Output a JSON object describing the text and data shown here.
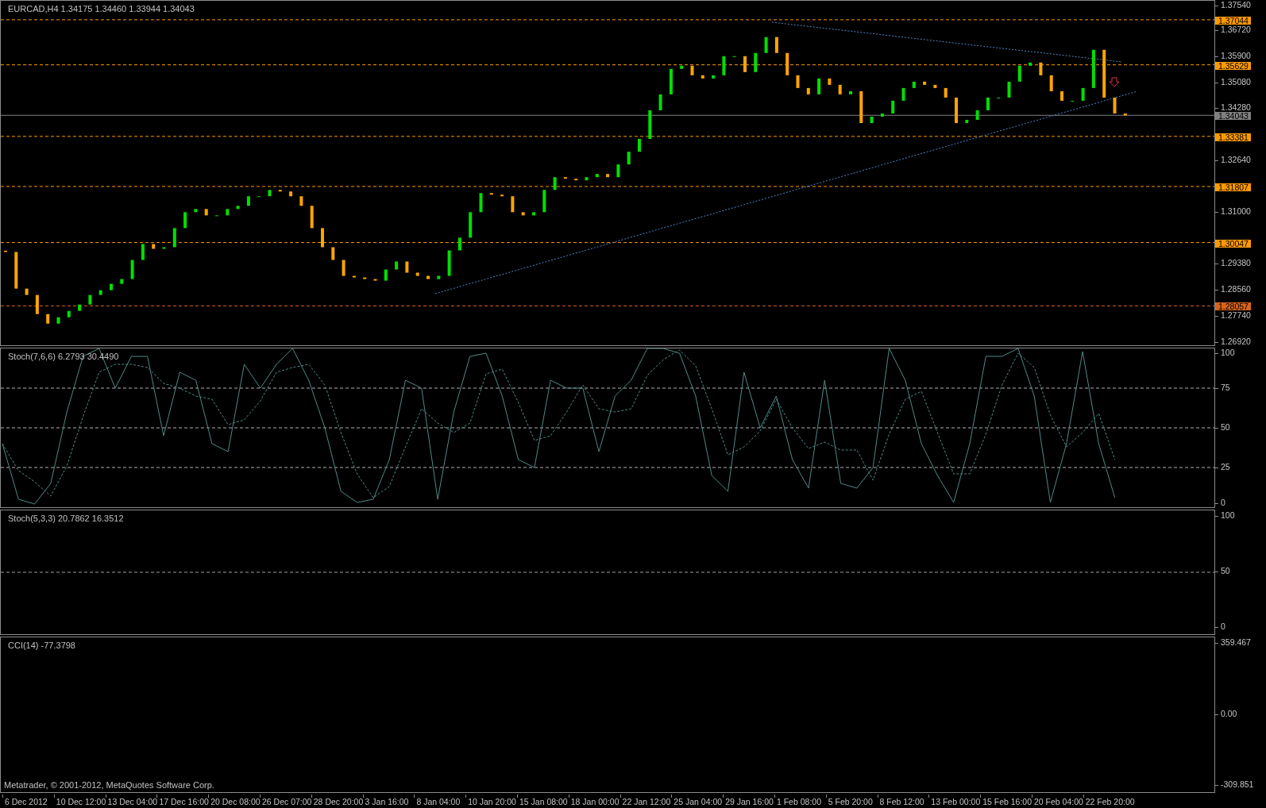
{
  "main_chart": {
    "title": "EURCAD,H4  1.34175 1.34460 1.33944 1.34043",
    "price_scale": [
      "1.37540",
      "1.36720",
      "1.35900",
      "1.35080",
      "1.34280",
      "1.32640",
      "1.31000",
      "1.29380",
      "1.28560",
      "1.27740",
      "1.26920"
    ],
    "levels": [
      {
        "label": "1.37044",
        "kind": "dashed",
        "color": "#ff9900"
      },
      {
        "label": "1.35629",
        "kind": "dashed",
        "color": "#ff9900"
      },
      {
        "label": "1.34043",
        "kind": "current",
        "color": "#808080"
      },
      {
        "label": "1.33381",
        "kind": "dashed",
        "color": "#ff9900"
      },
      {
        "label": "1.31807",
        "kind": "dashed",
        "color": "#ff9900"
      },
      {
        "label": "1.30047",
        "kind": "dashed",
        "color": "#ff9900"
      },
      {
        "label": "1.28057",
        "kind": "dashed",
        "color": "#d8641c"
      }
    ]
  },
  "stoch_panel": {
    "label": "Stoch(7,6,6) 6.2793 30.4490",
    "chart_data": {
      "type": "line",
      "ylim": [
        0,
        100
      ],
      "grid": true,
      "yticks": [
        {
          "value": 0,
          "label": "0"
        },
        {
          "value": 25,
          "label": "25"
        },
        {
          "value": 50,
          "label": "50"
        },
        {
          "value": 75,
          "label": "75"
        },
        {
          "value": 100,
          "label": "100"
        }
      ],
      "series": [
        {
          "color": "#4f8a86",
          "line_style": "solid",
          "values": [
            40,
            5,
            2,
            15,
            60,
            95,
            100,
            75,
            95,
            95,
            45,
            85,
            80,
            40,
            35,
            90,
            75,
            90,
            100,
            80,
            50,
            10,
            3,
            5,
            30,
            80,
            75,
            5,
            60,
            95,
            97,
            70,
            30,
            25,
            80,
            75,
            75,
            35,
            70,
            80,
            100,
            100,
            97,
            70,
            20,
            10,
            85,
            50,
            70,
            30,
            12,
            80,
            15,
            12,
            25,
            100,
            80,
            40,
            20,
            3,
            40,
            95,
            95,
            100,
            70,
            3,
            40,
            98,
            40,
            6
          ]
        },
        {
          "color": "#4f8a86",
          "line_style": "dashed",
          "values": [
            40,
            23,
            16,
            7,
            26,
            57,
            85,
            90,
            90,
            88,
            78,
            75,
            70,
            68,
            52,
            55,
            67,
            85,
            88,
            90,
            77,
            47,
            21,
            6,
            13,
            38,
            62,
            53,
            47,
            53,
            84,
            87,
            66,
            42,
            45,
            60,
            77,
            62,
            60,
            62,
            83,
            93,
            99,
            89,
            62,
            33,
            38,
            48,
            68,
            50,
            37,
            41,
            36,
            36,
            17,
            46,
            68,
            73,
            47,
            21,
            21,
            46,
            77,
            97,
            88,
            58,
            38,
            47,
            59,
            30
          ]
        }
      ]
    }
  },
  "stoch_panel_2": {
    "label": "Stoch(5,3,3) 20.7862 16.3512",
    "scale": [
      "100",
      "50",
      "0"
    ]
  },
  "cci_panel": {
    "label": "CCI(14) -77.3798",
    "scale": [
      "359.467",
      "0.00",
      "-309.851"
    ],
    "copyright": "Metatrader, © 2001-2012, MetaQuotes Software Corp."
  },
  "time_axis": [
    "6 Dec 2012",
    "10 Dec 12:00",
    "13 Dec 04:00",
    "17 Dec 16:00",
    "20 Dec 08:00",
    "26 Dec 07:00",
    "28 Dec 20:00",
    "3 Jan 16:00",
    "8 Jan 04:00",
    "10 Jan 20:00",
    "15 Jan 08:00",
    "18 Jan 00:00",
    "22 Jan 12:00",
    "25 Jan 04:00",
    "29 Jan 16:00",
    "1 Feb 08:00",
    "5 Feb 20:00",
    "8 Feb 12:00",
    "13 Feb 00:00",
    "15 Feb 16:00",
    "20 Feb 04:00",
    "22 Feb 20:00"
  ]
}
